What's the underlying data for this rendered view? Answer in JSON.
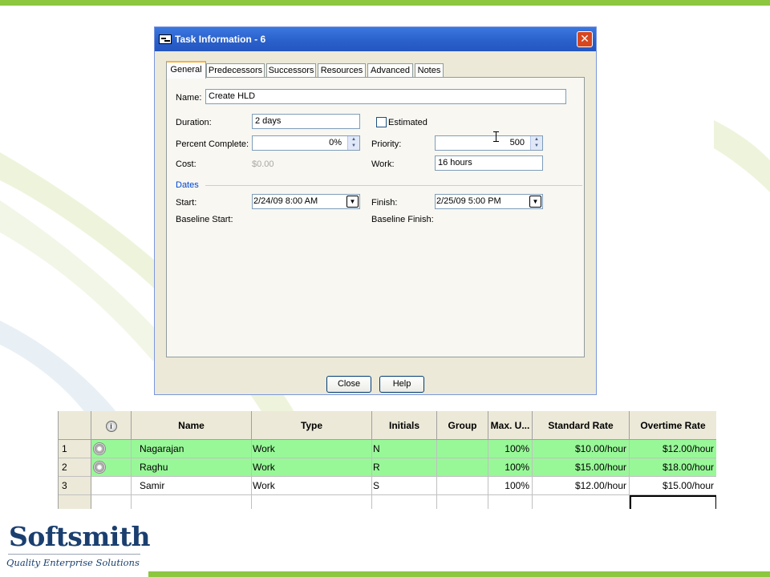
{
  "dialog": {
    "title": "Task Information - 6",
    "tabs": [
      "General",
      "Predecessors",
      "Successors",
      "Resources",
      "Advanced",
      "Notes"
    ],
    "active_tab": "General",
    "general": {
      "name_label": "Name:",
      "name_value": "Create HLD",
      "duration_label": "Duration:",
      "duration_value": "2 days",
      "estimated_label": "Estimated",
      "percent_label": "Percent Complete:",
      "percent_value": "0%",
      "priority_label": "Priority:",
      "priority_value": "500",
      "cost_label": "Cost:",
      "cost_value": "$0.00",
      "work_label": "Work:",
      "work_value": "16 hours",
      "dates_heading": "Dates",
      "start_label": "Start:",
      "start_value": "2/24/09 8:00 AM",
      "finish_label": "Finish:",
      "finish_value": "2/25/09 5:00 PM",
      "baseline_start_label": "Baseline Start:",
      "baseline_finish_label": "Baseline Finish:"
    },
    "buttons": {
      "close": "Close",
      "help": "Help"
    }
  },
  "resource_table": {
    "columns": [
      "",
      "i",
      "Name",
      "Type",
      "Initials",
      "Group",
      "Max. U...",
      "Standard Rate",
      "Overtime Rate"
    ],
    "rows": [
      {
        "num": "1",
        "name": "Nagarajan",
        "type": "Work",
        "initials": "N",
        "group": "",
        "max": "100%",
        "std": "$10.00/hour",
        "ot": "$12.00/hour",
        "highlighted": true
      },
      {
        "num": "2",
        "name": "Raghu",
        "type": "Work",
        "initials": "R",
        "group": "",
        "max": "100%",
        "std": "$15.00/hour",
        "ot": "$18.00/hour",
        "highlighted": true
      },
      {
        "num": "3",
        "name": "Samir",
        "type": "Work",
        "initials": "S",
        "group": "",
        "max": "100%",
        "std": "$12.00/hour",
        "ot": "$15.00/hour",
        "highlighted": false
      }
    ]
  },
  "logo": {
    "name": "Softsmith",
    "tagline": "Quality Enterprise Solutions"
  },
  "colors": {
    "accent_green": "#8dc63f",
    "row_highlight": "#98f898",
    "title_blue": "#2a5fc9",
    "logo_navy": "#1a3f6f"
  }
}
